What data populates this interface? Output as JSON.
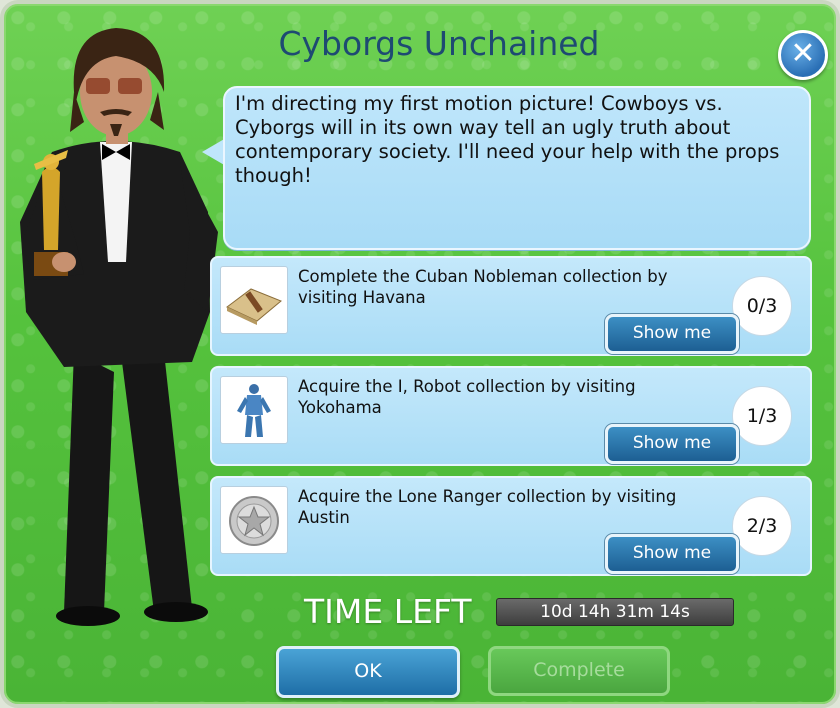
{
  "dialog": {
    "title": "Cyborgs Unchained",
    "close_icon": "close-x-icon",
    "speech": "I'm directing my first motion picture! Cowboys vs. Cyborgs will in its own way tell an ugly truth about contemporary society. I'll need your help with the props though!"
  },
  "tasks": [
    {
      "text": "Complete the Cuban Nobleman collection by visiting Havana",
      "progress": "0/3",
      "button": "Show me",
      "icon": "cigar-box-icon"
    },
    {
      "text": "Acquire the I, Robot collection by visiting Yokohama",
      "progress": "1/3",
      "button": "Show me",
      "icon": "robot-figure-icon"
    },
    {
      "text": "Acquire the Lone Ranger collection by visiting Austin",
      "progress": "2/3",
      "button": "Show me",
      "icon": "sheriff-badge-icon"
    }
  ],
  "timer": {
    "label": "TIME LEFT",
    "value": "10d 14h 31m 14s"
  },
  "buttons": {
    "ok": "OK",
    "complete": "Complete"
  },
  "colors": {
    "background_green": "#55c23d",
    "panel_blue": "#bfe6fb",
    "button_blue": "#1e6ea6",
    "title": "#1e4a72"
  }
}
